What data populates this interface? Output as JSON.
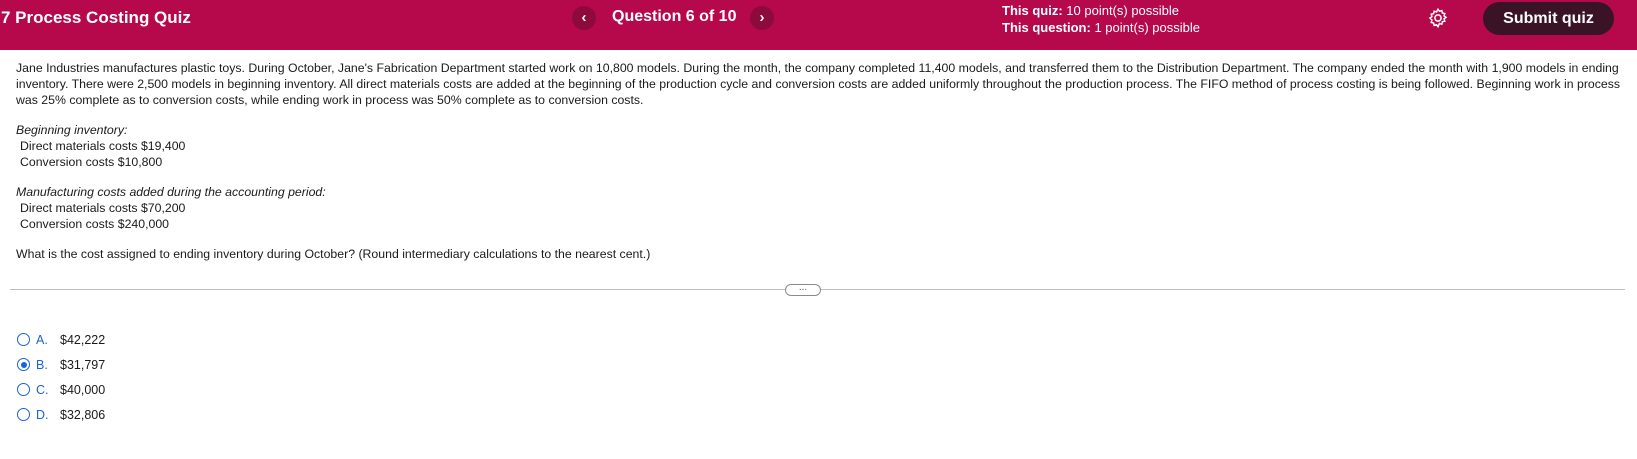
{
  "header": {
    "title": "7 Process Costing Quiz",
    "question_counter": "Question 6 of 10",
    "prev_icon": "chevron-left-icon",
    "next_icon": "chevron-right-icon",
    "quiz_points_label": "This quiz:",
    "quiz_points_value": "10 point(s) possible",
    "question_points_label": "This question:",
    "question_points_value": "1 point(s) possible",
    "settings_icon": "gear-icon",
    "submit_label": "Submit quiz",
    "accent_color": "#b5094c"
  },
  "problem": {
    "text": "Jane Industries manufactures plastic toys. During October, Jane's Fabrication Department started work on 10,800 models. During the month, the company completed 11,400 models, and transferred them to the Distribution Department. The company ended the month with 1,900 models in ending inventory. There were 2,500 models in beginning inventory. All direct materials costs are added at the beginning of the production cycle and conversion costs are added uniformly throughout the production process. The FIFO method of process costing is being followed. Beginning work in process was 25% complete as to conversion costs, while ending work in process was 50% complete as to conversion costs.",
    "beginning": {
      "title": "Beginning inventory:",
      "line1": "Direct materials costs $19,400",
      "line2": "Conversion costs $10,800"
    },
    "added": {
      "title": "Manufacturing costs added during the accounting period:",
      "line1": "Direct materials costs $70,200",
      "line2": "Conversion costs $240,000"
    },
    "question": "What is the cost assigned to ending inventory during October? (Round intermediary calculations to the nearest cent.)"
  },
  "divider_handle": "...",
  "options": [
    {
      "letter": "A.",
      "value": "$42,222",
      "selected": false
    },
    {
      "letter": "B.",
      "value": "$31,797",
      "selected": true
    },
    {
      "letter": "C.",
      "value": "$40,000",
      "selected": false
    },
    {
      "letter": "D.",
      "value": "$32,806",
      "selected": false
    }
  ]
}
